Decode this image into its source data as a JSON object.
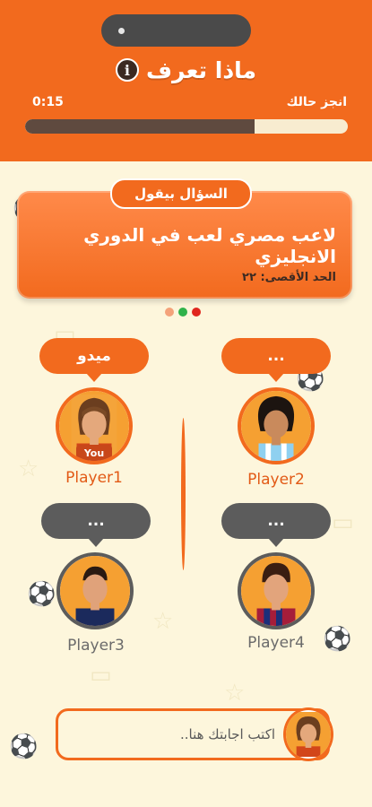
{
  "header": {
    "title": "ماذا تعرف",
    "info_icon": "info-icon",
    "timer_label": "انجز حالك",
    "timer_value": "0:15",
    "progress_fraction": 0.71
  },
  "question": {
    "tab_label": "السؤال بيقول",
    "text": "لاعب مصري لعب في الدوري الانجليزي",
    "limit": "الحد الأقصى: ٢٢",
    "dots": [
      "#f4a27a",
      "#2fb24a",
      "#e0261e"
    ]
  },
  "players": [
    {
      "name": "Player1",
      "bubble": "ميدو",
      "tag": "You"
    },
    {
      "name": "Player2",
      "bubble": "..."
    },
    {
      "name": "Player3",
      "bubble": "..."
    },
    {
      "name": "Player4",
      "bubble": "..."
    }
  ],
  "answer": {
    "placeholder": "اكتب اجابتك هنا.."
  },
  "colors": {
    "accent": "#f26a1e",
    "dark": "#5c5c5c",
    "background": "#fdf6dc"
  }
}
